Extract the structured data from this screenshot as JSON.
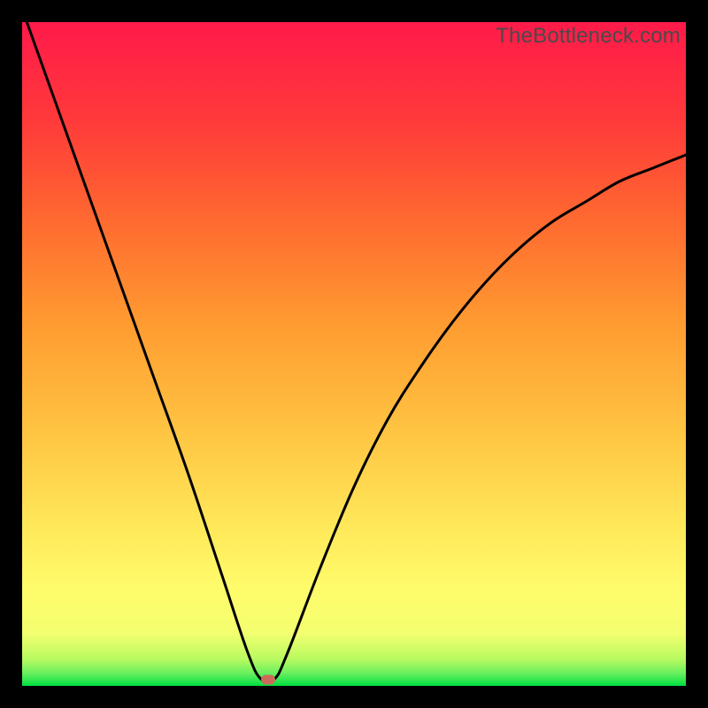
{
  "watermark": "TheBottleneck.com",
  "chart_data": {
    "type": "line",
    "title": "",
    "xlabel": "",
    "ylabel": "",
    "xlim": [
      0,
      1
    ],
    "ylim": [
      0,
      1
    ],
    "series": [
      {
        "name": "bottleneck-curve",
        "x": [
          0.0,
          0.05,
          0.1,
          0.15,
          0.2,
          0.25,
          0.3,
          0.34,
          0.36,
          0.38,
          0.4,
          0.45,
          0.5,
          0.55,
          0.6,
          0.65,
          0.7,
          0.75,
          0.8,
          0.85,
          0.9,
          0.95,
          1.0
        ],
        "values": [
          1.02,
          0.88,
          0.74,
          0.6,
          0.46,
          0.32,
          0.17,
          0.05,
          0.01,
          0.01,
          0.05,
          0.18,
          0.3,
          0.4,
          0.48,
          0.55,
          0.61,
          0.66,
          0.7,
          0.73,
          0.76,
          0.78,
          0.8
        ]
      }
    ],
    "optimal_point": {
      "x": 0.37,
      "y": 0.01
    },
    "gradient_stops": [
      {
        "pos": 0.0,
        "color": "#00e040"
      },
      {
        "pos": 0.15,
        "color": "#fffb6a"
      },
      {
        "pos": 0.5,
        "color": "#ff9a30"
      },
      {
        "pos": 1.0,
        "color": "#ff1a4a"
      }
    ]
  }
}
